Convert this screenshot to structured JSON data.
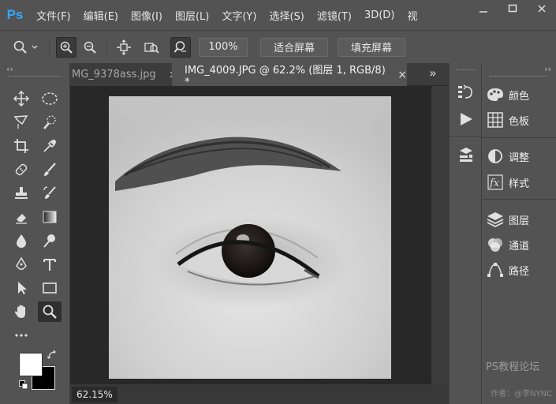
{
  "app": {
    "logo": "Ps"
  },
  "menu": [
    "文件(F)",
    "编辑(E)",
    "图像(I)",
    "图层(L)",
    "文字(Y)",
    "选择(S)",
    "滤镜(T)",
    "3D(D)",
    "视"
  ],
  "options_bar": {
    "zoom_value": "100%",
    "fit_screen": "适合屏幕",
    "fill_screen": "填充屏幕"
  },
  "tabs": [
    {
      "label": "MG_9378ass.jpg",
      "close": "×",
      "active": false
    },
    {
      "label": "IMG_4009.JPG @ 62.2% (图层 1, RGB/8) *",
      "close": "×",
      "active": true
    }
  ],
  "tab_overflow": "»",
  "status": {
    "zoom": "62.15%"
  },
  "panels": [
    {
      "label": "颜色",
      "icon": "palette-icon"
    },
    {
      "label": "色板",
      "icon": "swatches-icon"
    },
    {
      "label": "调整",
      "icon": "adjustments-icon"
    },
    {
      "label": "样式",
      "icon": "styles-icon"
    },
    {
      "label": "图层",
      "icon": "layers-icon"
    },
    {
      "label": "通道",
      "icon": "channels-icon"
    },
    {
      "label": "路径",
      "icon": "paths-icon"
    }
  ],
  "watermark": {
    "line1": "PS教程论坛",
    "line2": "作者：@李NYNC"
  },
  "colors": {
    "foreground": "#ffffff",
    "background": "#000000",
    "accent": "#31a8ff"
  }
}
